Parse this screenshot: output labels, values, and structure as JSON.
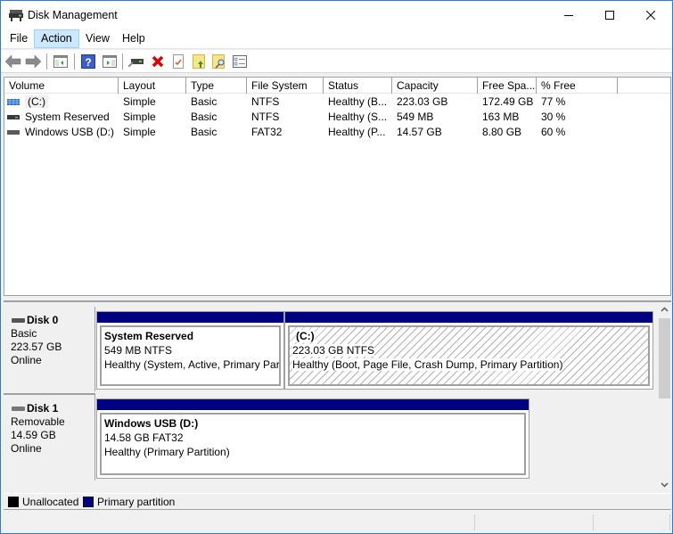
{
  "window": {
    "title": "Disk Management",
    "controls": {
      "minimize": "minimize",
      "maximize": "maximize",
      "close": "close"
    }
  },
  "menu": [
    {
      "label": "File"
    },
    {
      "label": "Action",
      "active": true
    },
    {
      "label": "View"
    },
    {
      "label": "Help"
    }
  ],
  "toolbar": [
    {
      "icon": "back-arrow-icon",
      "tooltip": "Back"
    },
    {
      "icon": "forward-arrow-icon",
      "tooltip": "Forward"
    },
    {
      "icon": "show-hide-console-tree-icon"
    },
    {
      "icon": "help-icon"
    },
    {
      "icon": "show-hide-action-pane-icon"
    },
    {
      "icon": "connect-disk-icon"
    },
    {
      "icon": "delete-icon"
    },
    {
      "icon": "properties-checkmark-icon"
    },
    {
      "icon": "folder-up-icon"
    },
    {
      "icon": "folder-search-icon"
    },
    {
      "icon": "task-list-icon"
    }
  ],
  "volume_list": {
    "columns": [
      "Volume",
      "Layout",
      "Type",
      "File System",
      "Status",
      "Capacity",
      "Free Spa...",
      "% Free"
    ],
    "rows": [
      {
        "volume": "(C:)",
        "icon": "striped-volume",
        "layout": "Simple",
        "type": "Basic",
        "fs": "NTFS",
        "status": "Healthy (B...",
        "capacity": "223.03 GB",
        "free": "172.49 GB",
        "pct": "77 %"
      },
      {
        "volume": "System Reserved",
        "icon": "drive",
        "layout": "Simple",
        "type": "Basic",
        "fs": "NTFS",
        "status": "Healthy (S...",
        "capacity": "549 MB",
        "free": "163 MB",
        "pct": "30 %"
      },
      {
        "volume": "Windows USB (D:)",
        "icon": "drive",
        "layout": "Simple",
        "type": "Basic",
        "fs": "FAT32",
        "status": "Healthy (P...",
        "capacity": "14.57 GB",
        "free": "8.80 GB",
        "pct": "60 %"
      }
    ]
  },
  "disks": [
    {
      "name": "Disk 0",
      "type": "Basic",
      "size": "223.57 GB",
      "state": "Online",
      "partitions": [
        {
          "name": "System Reserved",
          "size_fs": "549 MB NTFS",
          "status": "Healthy (System, Active, Primary Part",
          "selected": false
        },
        {
          "name": "(C:)",
          "size_fs": "223.03 GB NTFS",
          "status": "Healthy (Boot, Page File, Crash Dump, Primary Partition)",
          "selected": true
        }
      ]
    },
    {
      "name": "Disk 1",
      "type": "Removable",
      "size": "14.59 GB",
      "state": "Online",
      "partitions": [
        {
          "name": "Windows USB  (D:)",
          "size_fs": "14.58 GB FAT32",
          "status": "Healthy (Primary Partition)",
          "selected": false
        }
      ]
    }
  ],
  "legend": [
    {
      "label": "Unallocated",
      "color": "#000000"
    },
    {
      "label": "Primary partition",
      "color": "#000080"
    }
  ],
  "colors": {
    "primary_partition": "#000080",
    "unallocated": "#000000",
    "window_border": "#2b7cd3",
    "menu_active_bg": "#cce8ff"
  }
}
